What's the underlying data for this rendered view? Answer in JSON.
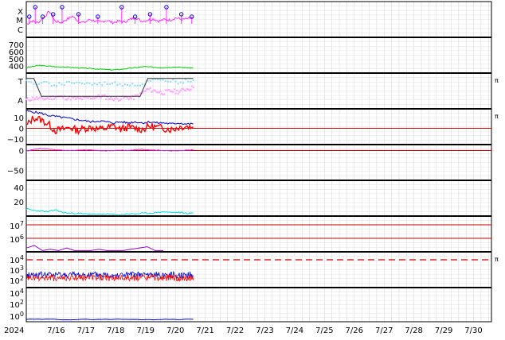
{
  "chart_data": {
    "type": "line",
    "x_start_label": "2024",
    "x_ticks": [
      "7/16",
      "7/17",
      "7/18",
      "7/19",
      "7/20",
      "7/21",
      "7/22",
      "7/23",
      "7/24",
      "7/25",
      "7/26",
      "7/27",
      "7/28",
      "7/29",
      "7/30"
    ],
    "x_range_days": [
      15.0,
      30.6
    ],
    "data_end_day": 20.6,
    "panels": [
      {
        "id": "xmc",
        "y_labels": [
          "X",
          "M",
          "C"
        ],
        "series": [
          {
            "color": "#ff33ff",
            "values": [
              0.35,
              0.45,
              0.4,
              0.55,
              0.75,
              0.45,
              0.4,
              0.5,
              0.6,
              0.45,
              0.4,
              0.5,
              0.45,
              0.42,
              0.48,
              0.4,
              0.45,
              0.42,
              0.5,
              0.55,
              0.45,
              0.48,
              0.52,
              0.45,
              0.5,
              0.48,
              0.55,
              0.5,
              0.52,
              0.55
            ]
          },
          {
            "color": "#0000cc",
            "role": "flare-markers",
            "days": [
              15.1,
              15.3,
              15.55,
              15.9,
              16.2,
              16.75,
              17.4,
              18.2,
              18.65,
              19.15,
              19.7,
              20.2,
              20.55
            ]
          }
        ]
      },
      {
        "id": "speed",
        "y_ticks": [
          400,
          500,
          600,
          700
        ],
        "y_range": [
          300,
          800
        ],
        "series": [
          {
            "color": "#00cc00",
            "values": [
              380,
              390,
              410,
              400,
              395,
              385,
              390,
              380,
              375,
              370,
              365,
              360,
              355,
              350,
              345,
              350,
              360,
              370,
              380,
              390,
              385,
              380,
              375,
              380,
              385,
              380,
              375,
              370
            ]
          }
        ]
      },
      {
        "id": "ta",
        "y_labels": [
          "T",
          "A"
        ],
        "series": [
          {
            "color": "#ffaaff",
            "role": "A",
            "values": [
              0.25,
              0.3,
              0.28,
              0.3,
              0.35,
              0.32,
              0.3,
              0.28,
              0.3,
              0.33,
              0.35,
              0.3,
              0.28,
              0.32,
              0.3,
              0.4,
              0.55,
              0.5,
              0.45,
              0.5,
              0.48,
              0.55,
              0.6
            ]
          },
          {
            "color": "#88ddff",
            "role": "T",
            "values": [
              0.75,
              0.7,
              0.72,
              0.7,
              0.68,
              0.7,
              0.75,
              0.72,
              0.7,
              0.68,
              0.7,
              0.72,
              0.7,
              0.68,
              0.7,
              0.65,
              0.75,
              0.8,
              0.78,
              0.8,
              0.75,
              0.78,
              0.8
            ]
          },
          {
            "color": "#333333",
            "role": "step",
            "values": [
              0.85,
              0.85,
              0.35,
              0.35,
              0.35,
              0.35,
              0.35,
              0.35,
              0.35,
              0.35,
              0.35,
              0.35,
              0.35,
              0.35,
              0.35,
              0.35,
              0.85,
              0.85,
              0.85,
              0.85,
              0.85,
              0.85,
              0.85
            ]
          }
        ],
        "right_marker": "π"
      },
      {
        "id": "bfield",
        "y_ticks": [
          10,
          0,
          -10
        ],
        "y_range": [
          -15,
          18
        ],
        "zero_line_color": "#cc0000",
        "series": [
          {
            "color": "#0000cc",
            "values": [
              16,
              15,
              14,
              12,
              11,
              10,
              9,
              8,
              7,
              6,
              7,
              6,
              5,
              6,
              5,
              6,
              5,
              6,
              5,
              5,
              4,
              5,
              4,
              4
            ]
          },
          {
            "color": "#ff0000",
            "values": [
              2,
              10,
              8,
              4,
              -2,
              -1,
              1,
              -2,
              0,
              1,
              -1,
              0,
              2,
              -1,
              1,
              0,
              -1,
              2,
              1,
              0,
              -1,
              1,
              2,
              1
            ]
          }
        ],
        "right_marker": "π"
      },
      {
        "id": "bz",
        "y_ticks": [
          0,
          -50
        ],
        "y_range": [
          -75,
          15
        ],
        "zero_line_color": "#cc0000",
        "series": [
          {
            "color": "#cc33ff",
            "values": [
              -2,
              3,
              5,
              4,
              2,
              1,
              0,
              1,
              2,
              1,
              0,
              -1,
              0,
              1,
              0,
              2,
              3,
              2,
              1,
              0,
              -1,
              0,
              1,
              2
            ]
          }
        ]
      },
      {
        "id": "density",
        "y_ticks": [
          20,
          40
        ],
        "y_range": [
          0,
          50
        ],
        "series": [
          {
            "color": "#00dddd",
            "values": [
              10,
              8,
              7,
              6,
              9,
              5,
              4,
              4,
              3,
              3,
              2,
              3,
              2,
              2,
              3,
              3,
              4,
              4,
              5,
              6,
              5,
              5,
              4,
              4
            ]
          }
        ]
      },
      {
        "id": "proton",
        "y_ticks": [
          "10^7",
          "10^6"
        ],
        "hlines_color": "#cc0000",
        "series": [
          {
            "color": "#9900cc",
            "values": [
              0.3,
              0.5,
              0.1,
              0.2,
              0.1,
              0.3,
              0.1,
              0.1,
              0.1,
              0.2,
              0.1,
              0.1,
              0.1,
              0.2,
              0.3,
              0.4,
              0.1,
              0.1
            ]
          }
        ]
      },
      {
        "id": "electron",
        "y_ticks": [
          "10^4",
          "10^3",
          "10^2"
        ],
        "dashed_line_color": "#cc0000",
        "series": [
          {
            "color": "#0000cc",
            "role": "noise-high"
          },
          {
            "color": "#ff0000",
            "role": "noise-low"
          }
        ],
        "right_marker": "π"
      },
      {
        "id": "kp",
        "y_ticks": [
          "10^4",
          "10^2",
          "10^0"
        ],
        "series": [
          {
            "color": "#0000cc",
            "values": [
              0.05,
              0.05,
              0.04,
              0.05,
              0.05,
              0.04,
              0.05,
              0.05
            ]
          }
        ]
      }
    ]
  }
}
